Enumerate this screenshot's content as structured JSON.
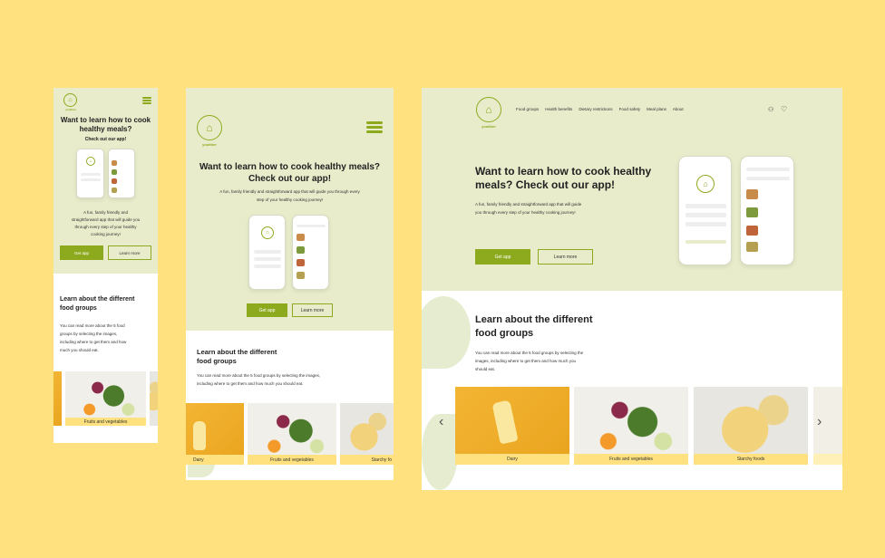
{
  "brand": {
    "name": "youthier"
  },
  "nav": [
    "Food groups",
    "Health benefits",
    "Dietary restrictions",
    "Food safety",
    "Meal plans",
    "About"
  ],
  "hero": {
    "title_a": "Want to learn how to cook",
    "title_b": "healthy meals?",
    "tablet_title_a": "Want to learn how to cook healthy meals?",
    "tablet_title_b": "Check out our app!",
    "desktop_title_a": "Want to learn how to cook healthy",
    "desktop_title_b": "meals? Check out our app!",
    "subtitle": "Check out our app!",
    "desc": "A fun, family friendly and straightforward app that will guide you through every step of your healthy cooking journey!",
    "mobile_desc_1": "A fun, family friendly and",
    "mobile_desc_2": "straightforward app that will guide you",
    "mobile_desc_3": "through every step of your healthy",
    "mobile_desc_4": "cooking journey!",
    "tablet_desc_1": "A fun, family friendly and straightforward app that will guide you through every",
    "tablet_desc_2": "step of your healthy cooking journey!",
    "desktop_desc_1": "A fun, family friendly and straightforward app that will guide",
    "desktop_desc_2": "you through every step of your healthy cooking journey!",
    "get_app": "Get app",
    "learn_more": "Learn more"
  },
  "food": {
    "title_a": "Learn about the different",
    "title_b": "food groups",
    "mobile_desc_1": "You can read more about the 5 food",
    "mobile_desc_2": "groups by selecting the images,",
    "mobile_desc_3": "including where to get them and how",
    "mobile_desc_4": "much you should eat.",
    "tablet_desc_1": "You can read more about the 5 food groups by selecting the images,",
    "tablet_desc_2": "including where to get them and how much you should eat.",
    "desktop_desc_1": "You can read more about the 5 food groups by selecting the",
    "desktop_desc_2": "images, including where to get them and how much you",
    "desktop_desc_3": "should eat.",
    "tiles": [
      "Dairy",
      "Fruits and vegetables",
      "Starchy foods",
      "Starchy fo"
    ]
  },
  "colors": {
    "accent": "#8DAA1F",
    "hero_bg": "#E8ECCB",
    "page_bg": "#FFE27F",
    "caption_bg": "#FFE27F"
  },
  "icons": [
    "logo-icon",
    "menu-icon",
    "user-icon",
    "heart-icon",
    "chevron-left-icon",
    "chevron-right-icon"
  ]
}
